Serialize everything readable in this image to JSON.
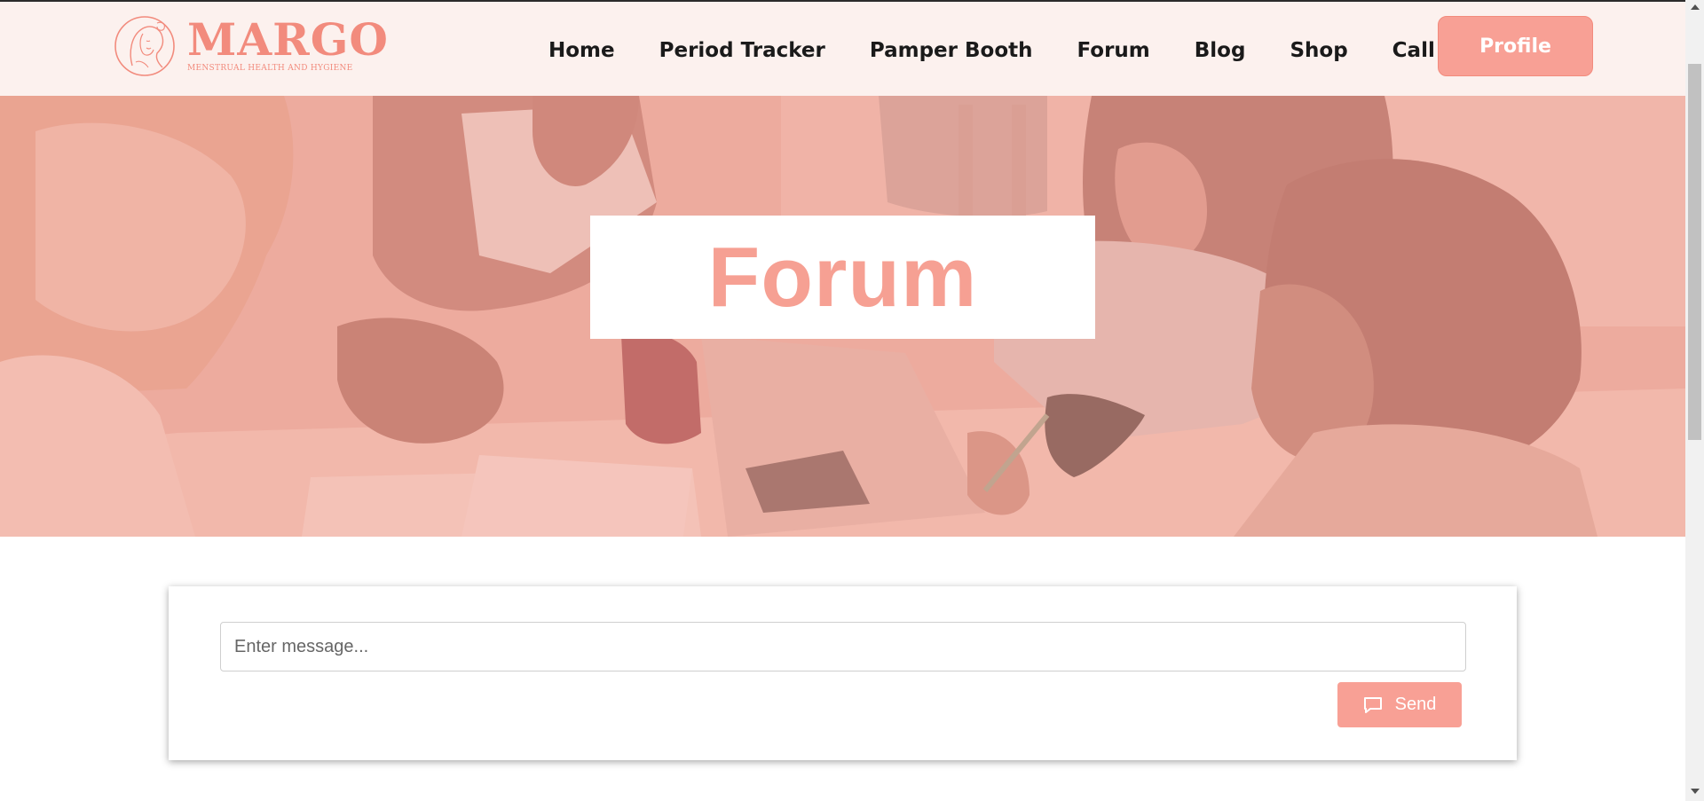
{
  "brand": {
    "name": "MARGO",
    "tagline": "MENSTRUAL HEALTH AND HYGIENE",
    "emblem_icon": "woman-portrait-logo",
    "color": "#f28b7d"
  },
  "nav": {
    "items": [
      {
        "label": "Home"
      },
      {
        "label": "Period Tracker"
      },
      {
        "label": "Pamper Booth"
      },
      {
        "label": "Forum"
      },
      {
        "label": "Blog"
      },
      {
        "label": "Shop"
      },
      {
        "label": "Call"
      }
    ],
    "profile_label": "Profile"
  },
  "hero": {
    "title": "Forum",
    "background": "photo of young women around a table with a laptop, pink overlay"
  },
  "chat": {
    "placeholder": "Enter message...",
    "value": "",
    "send_label": "Send",
    "send_icon": "chat-bubble-icon"
  },
  "theme": {
    "accent": "#f8a095",
    "nav_bg": "#fcf1ee",
    "hero_overlay": "#f2a395"
  }
}
